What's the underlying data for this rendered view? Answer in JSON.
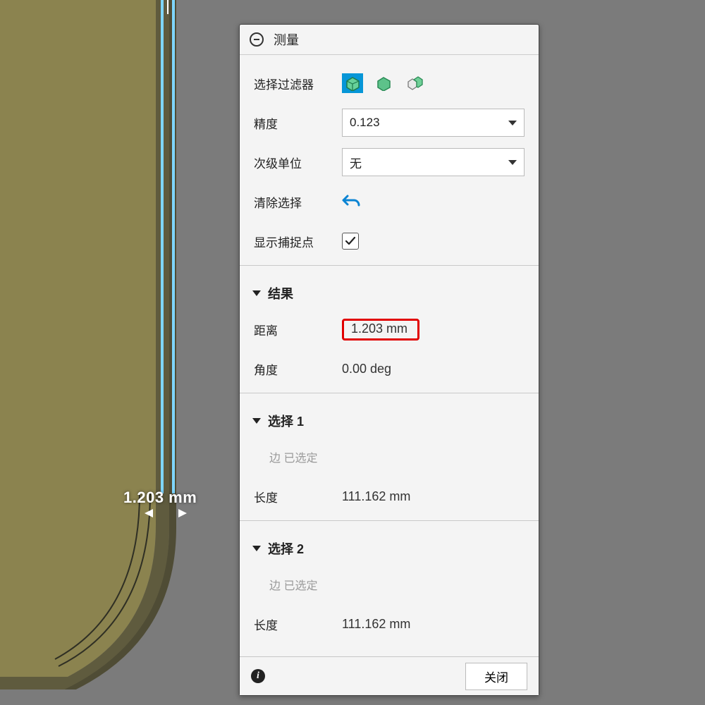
{
  "panel": {
    "title": "测量",
    "filter_label": "选择过滤器",
    "precision_label": "精度",
    "precision_value": "0.123",
    "subunit_label": "次级单位",
    "subunit_value": "无",
    "clear_label": "清除选择",
    "snap_label": "显示捕捉点",
    "snap_checked": true,
    "results_header": "结果",
    "distance_label": "距离",
    "distance_value": "1.203 mm",
    "angle_label": "角度",
    "angle_value": "0.00 deg",
    "sel1_header": "选择 1",
    "sel1_status": "边 已选定",
    "length_label": "长度",
    "sel1_length": "111.162 mm",
    "sel2_header": "选择 2",
    "sel2_status": "边 已选定",
    "sel2_length": "111.162 mm",
    "close_label": "关闭"
  },
  "canvas_annotation": "1.203 mm"
}
